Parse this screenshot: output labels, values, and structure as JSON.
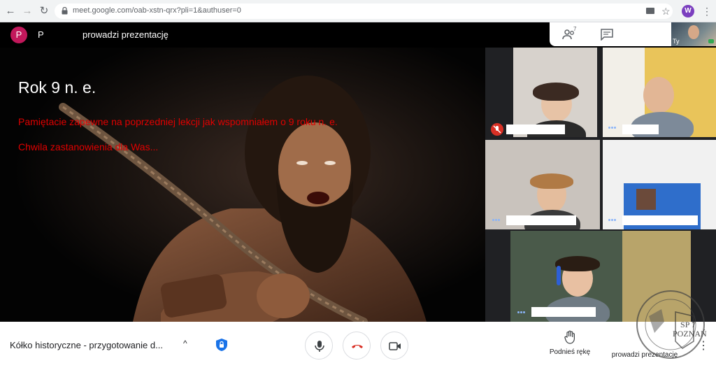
{
  "browser": {
    "url": "meet.google.com/oab-xstn-qrx?pli=1&authuser=0",
    "back_icon": "back-arrow-icon",
    "forward_icon": "forward-arrow-icon",
    "reload_icon": "reload-icon",
    "profile_initial": "W",
    "menu_glyph": "⋮",
    "star_glyph": "☆"
  },
  "meet_header": {
    "presenter_avatar_letter": "P",
    "presenter_initial": "P",
    "presenter_status": "prowadzi prezentację",
    "participants_icon": "people-icon",
    "participants_count": "7",
    "chat_icon": "chat-icon",
    "self_label": "Ty"
  },
  "slide": {
    "title": "Rok 9 n. e.",
    "lines": [
      "Pamiętacie zapewne na poprzedniej lekcji jak wspomniałem o 9 roku n. e.",
      "Chwila zastanowienia dla Was..."
    ]
  },
  "participants": [
    {
      "muted": true
    },
    {
      "muted": false
    },
    {
      "muted": false
    },
    {
      "muted": false
    },
    {
      "muted": false
    }
  ],
  "bottom_bar": {
    "meeting_name": "Kółko historyczne - przygotowanie d...",
    "expand_glyph": "^",
    "raise_hand_label": "Podnieś rękę",
    "presenting_label": "prowadzi prezentację",
    "more_glyph": "⋮"
  },
  "watermark": {
    "text": "SP 7 POZNAŃ"
  }
}
